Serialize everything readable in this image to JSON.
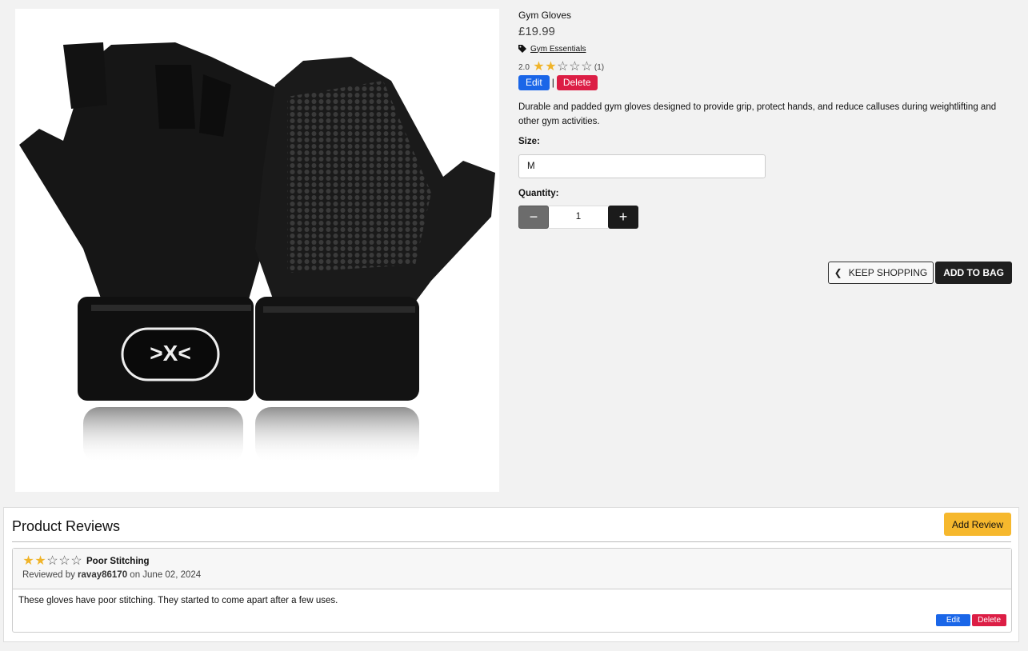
{
  "product": {
    "name": "Gym Gloves",
    "price": "£19.99",
    "category": "Gym Essentials",
    "rating_value": "2.0",
    "rating_stars": 2,
    "rating_count": "(1)",
    "edit_label": "Edit",
    "separator": "|",
    "delete_label": "Delete",
    "description": "Durable and padded gym gloves designed to provide grip, protect hands, and reduce calluses during weightlifting and other gym activities.",
    "image_logo_icon": "glove-brand-logo"
  },
  "form": {
    "size_label": "Size:",
    "size_value": "M",
    "quantity_label": "Quantity:",
    "quantity_value": "1",
    "minus_symbol": "−",
    "plus_symbol": "+",
    "keep_shopping_label": "KEEP SHOPPING",
    "add_to_bag_label": "ADD TO BAG"
  },
  "reviews": {
    "heading": "Product Reviews",
    "add_review_label": "Add Review",
    "items": [
      {
        "stars": 2,
        "title": "Poor Stitching",
        "reviewed_by_prefix": "Reviewed by",
        "author": "ravay86170",
        "date_text": "on June 02, 2024",
        "body": "These gloves have poor stitching. They started to come apart after a few uses.",
        "edit_label": "Edit",
        "delete_label": "Delete"
      }
    ]
  },
  "colors": {
    "edit": "#1a66e8",
    "delete": "#dc1e45",
    "add_review": "#f6b82d",
    "star_on": "#f0b429"
  }
}
